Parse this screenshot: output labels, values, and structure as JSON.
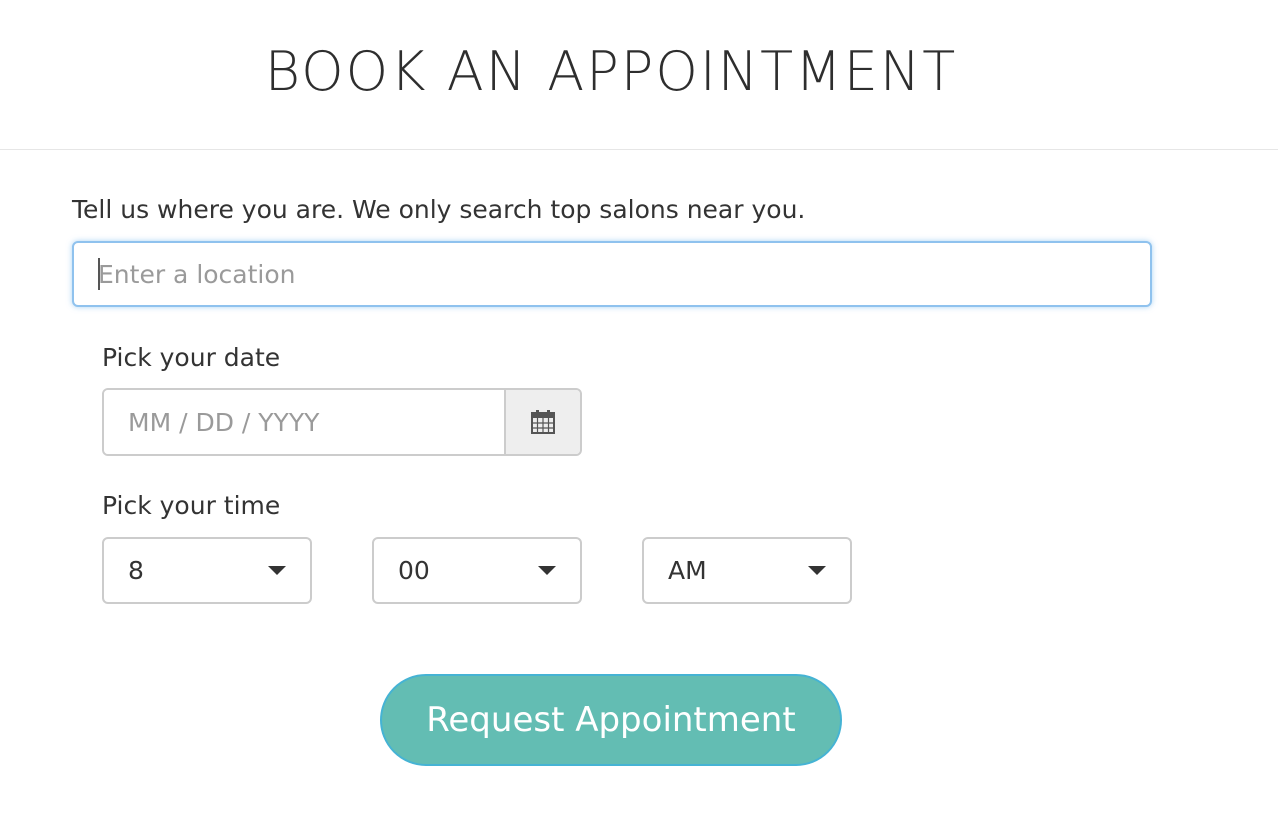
{
  "header": {
    "title": "BOOK AN APPOINTMENT"
  },
  "location": {
    "label": "Tell us where you are. We only search top salons near you.",
    "placeholder": "Enter a location",
    "value": ""
  },
  "date": {
    "label": "Pick your date",
    "placeholder": "MM / DD / YYYY",
    "value": "",
    "button_icon": "calendar-icon"
  },
  "time": {
    "label": "Pick your time",
    "hour": "8",
    "minute": "00",
    "period": "AM"
  },
  "submit": {
    "label": "Request Appointment"
  },
  "colors": {
    "accent": "#63bdb3",
    "focus_border": "#8fc2ee"
  }
}
